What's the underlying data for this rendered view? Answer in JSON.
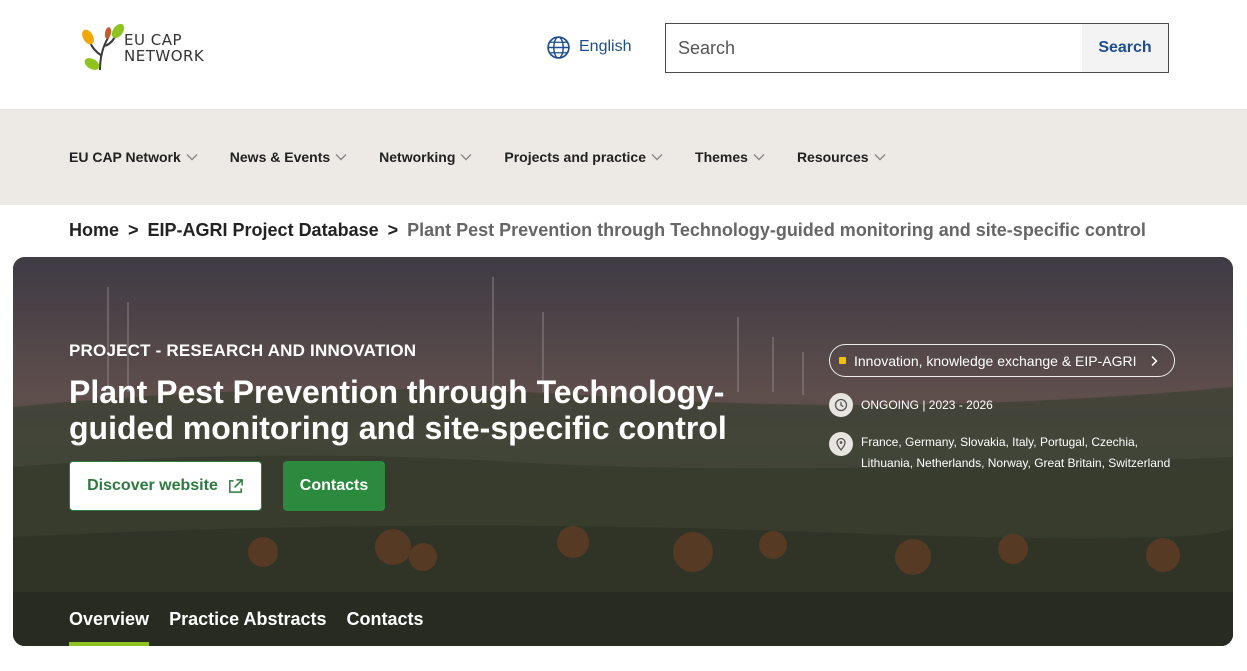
{
  "header": {
    "logo_line1": "EU CAP",
    "logo_line2": "NETWORK",
    "language": "English",
    "search_placeholder": "Search",
    "search_button": "Search"
  },
  "nav": {
    "items": [
      {
        "label": "EU CAP Network"
      },
      {
        "label": "News & Events"
      },
      {
        "label": "Networking"
      },
      {
        "label": "Projects and practice"
      },
      {
        "label": "Themes"
      },
      {
        "label": "Resources"
      }
    ]
  },
  "breadcrumb": {
    "home": "Home",
    "database": "EIP-AGRI Project Database",
    "current": "Plant Pest Prevention through Technology-guided monitoring and site-specific control",
    "separator": ">"
  },
  "hero": {
    "kicker": "PROJECT - RESEARCH AND INNOVATION",
    "title": "Plant Pest Prevention through Technology-guided monitoring and site-specific control",
    "discover_button": "Discover website",
    "contacts_button": "Contacts",
    "theme_tag": "Innovation, knowledge exchange & EIP-AGRI",
    "status": "ONGOING | 2023 - 2026",
    "countries": "France, Germany, Slovakia, Italy, Portugal, Czechia, Lithuania, Netherlands, Norway, Great Britain, Switzerland"
  },
  "tabs": [
    {
      "label": "Overview",
      "active": true
    },
    {
      "label": "Practice Abstracts",
      "active": false
    },
    {
      "label": "Contacts",
      "active": false
    }
  ],
  "colors": {
    "primary_green": "#2b8a3e",
    "link_blue": "#1f4e8c",
    "nav_bg": "#ede9e4",
    "tab_underline": "#8fc31f",
    "theme_dot": "#f2c200"
  },
  "icons": {
    "language": "globe-icon",
    "external": "external-link-icon",
    "status": "clock-icon",
    "location": "map-pin-icon",
    "theme_arrow": "chevron-right-icon",
    "nav_chevron": "chevron-down-icon"
  }
}
